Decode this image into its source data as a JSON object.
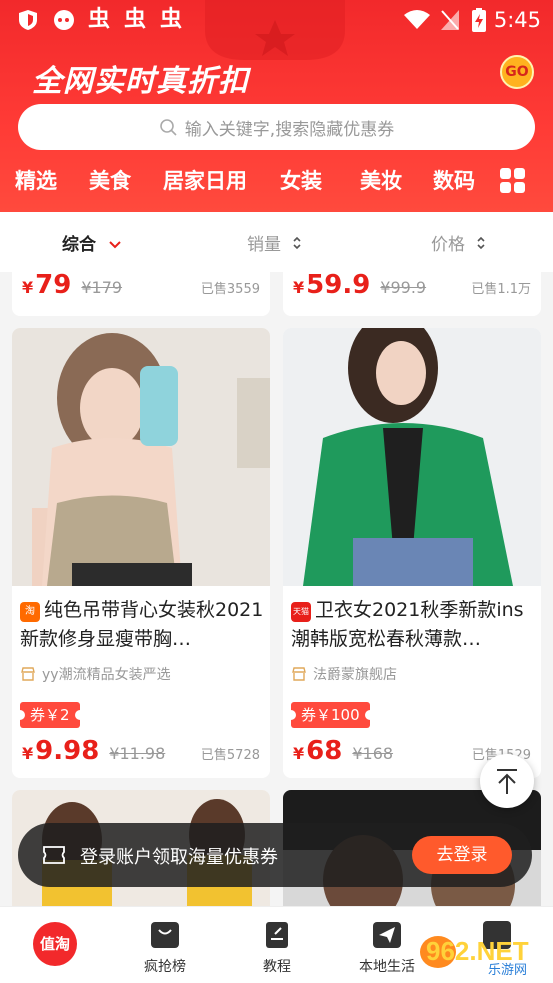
{
  "status_bar": {
    "time": "5:45",
    "app_icons": [
      "shield-icon",
      "chat-icon",
      "bug-icon",
      "bug-icon",
      "bug-icon"
    ]
  },
  "header": {
    "banner": "全网实时真折扣",
    "go_badge": "GO"
  },
  "search": {
    "placeholder": "输入关键字,搜索隐藏优惠券"
  },
  "categories": [
    "精选",
    "美食",
    "居家日用",
    "女装",
    "美妆",
    "数码"
  ],
  "sort": {
    "items": [
      "综合",
      "销量",
      "价格"
    ],
    "active": "综合"
  },
  "prev_row": [
    {
      "yen": "¥",
      "price": "79",
      "original": "¥179",
      "sold": "已售3559"
    },
    {
      "yen": "¥",
      "price": "59.9",
      "original": "¥99.9",
      "sold": "已售1.1万"
    }
  ],
  "products": [
    {
      "platform": "淘",
      "platform_color": "#ff6a00",
      "title": "纯色吊带背心女装秋2021新款修身显瘦带胸…",
      "shop": "yy潮流精品女装严选",
      "coupon": "券￥2",
      "yen": "¥",
      "price": "9.98",
      "original": "¥11.98",
      "sold": "已售5728"
    },
    {
      "platform": "天猫",
      "platform_color": "#e8201a",
      "title": "卫衣女2021秋季新款ins潮韩版宽松春秋薄款…",
      "shop": "法爵蒙旗舰店",
      "coupon": "券￥100",
      "yen": "¥",
      "price": "68",
      "original": "¥168",
      "sold": "已售1529"
    }
  ],
  "login_bar": {
    "text": "登录账户领取海量优惠券",
    "button": "去登录"
  },
  "tabbar": {
    "home_badge": "值淘",
    "items": [
      "疯抢榜",
      "教程",
      "本地生活"
    ]
  },
  "watermark": {
    "text": "962.NET",
    "sub": "乐游网"
  },
  "colors": {
    "brand_red": "#f2292b",
    "price_red": "#e8201a",
    "login_orange": "#ff5a2c"
  }
}
